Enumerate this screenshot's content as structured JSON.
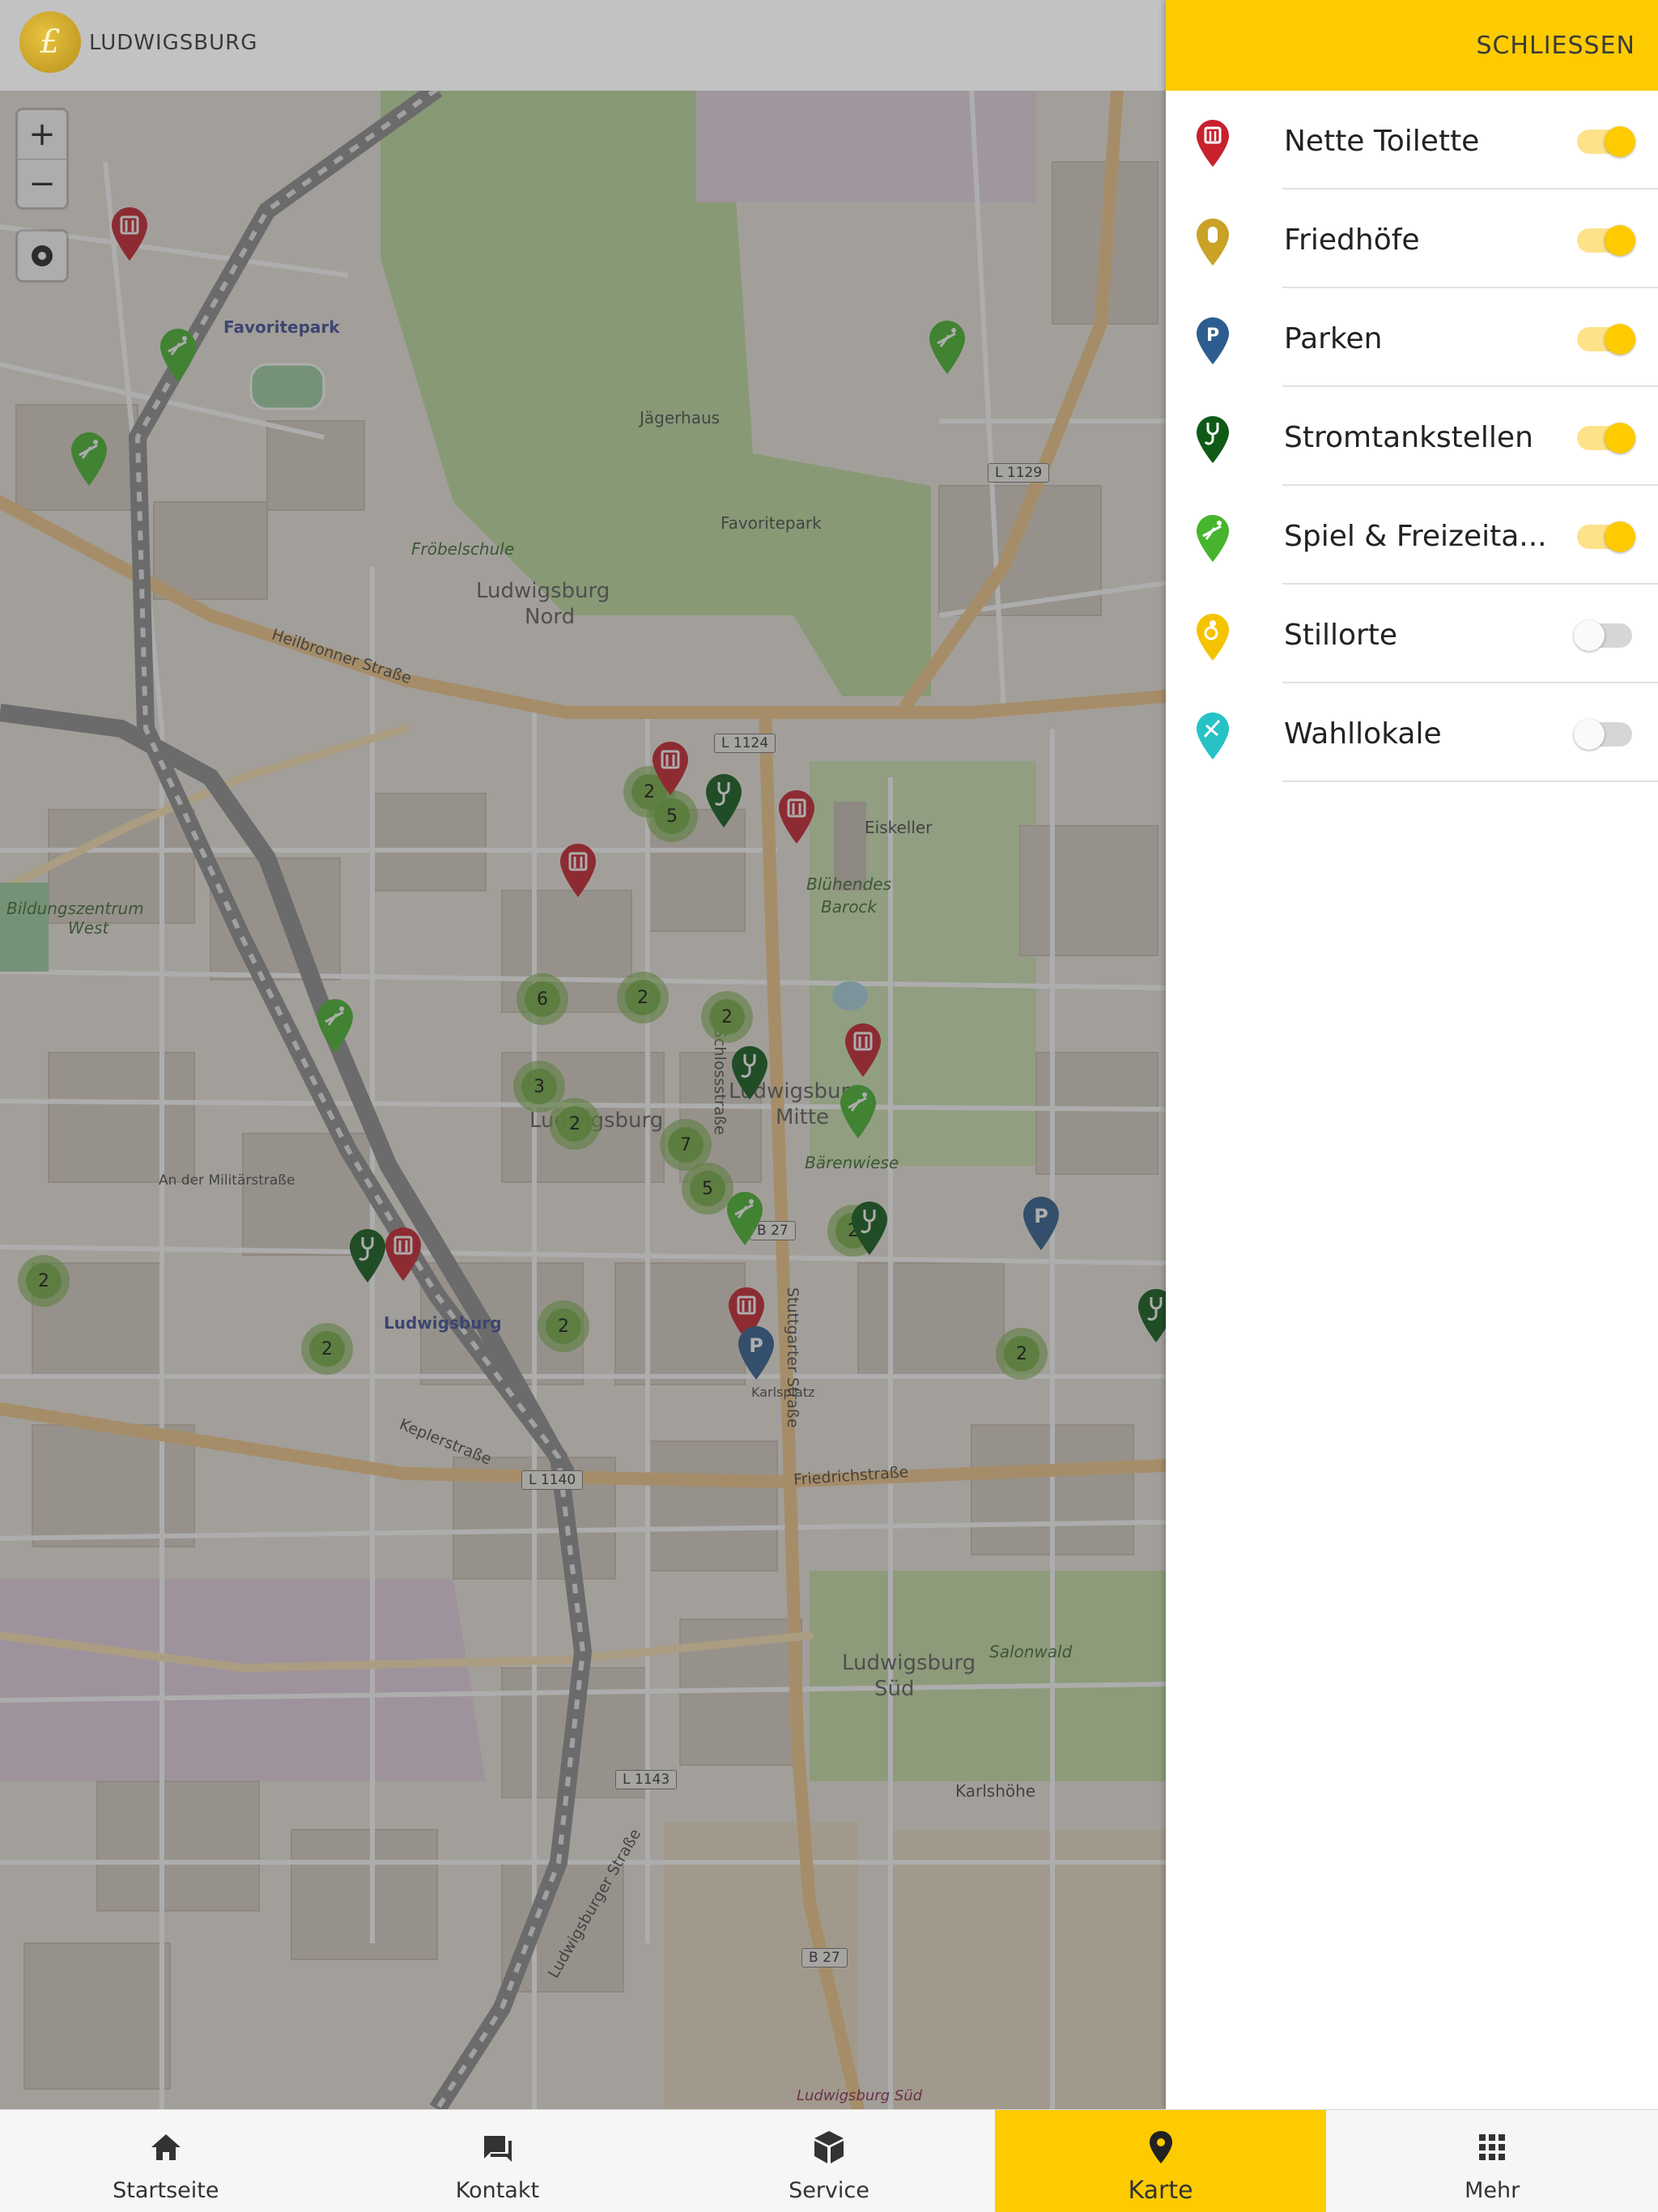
{
  "header": {
    "brand": "LUDWIGSBURG",
    "logo_letter": "£"
  },
  "map": {
    "zoom_in": "+",
    "zoom_out": "−",
    "labels": {
      "favoritepark_blue": "Favoritepark",
      "jaegerhaus": "Jägerhaus",
      "favoritepark": "Favoritepark",
      "frobelschule": "Fröbelschule",
      "ludwigsburg_nord_1": "Ludwigsburg",
      "ludwigsburg_nord_2": "Nord",
      "heilbronner": "Heilbronner Straße",
      "bluehendes_1": "Blühendes",
      "bluehendes_2": "Barock",
      "eiskeller": "Eiskeller",
      "bildungszentrum_1": "Bildungszentrum",
      "bildungszentrum_2": "West",
      "ludwigsburg_mitte_1": "Ludwigsburg",
      "ludwigsburg_mitte_2": "Mitte",
      "barenwiese": "Bärenwiese",
      "ludwigsburg_center": "Ludwigsburg",
      "ludwigsburg_blue": "Ludwigsburg",
      "an_der_militaerstrasse": "An der Militärstraße",
      "friedrichstrasse": "Friedrichstraße",
      "keplerstrasse": "Keplerstraße",
      "salonwald": "Salonwald",
      "ludwigsburg_sued_1": "Ludwigsburg",
      "ludwigsburg_sued_2": "Süd",
      "karlshoehe": "Karlshöhe",
      "schlossstrasse": "Schlossstraße",
      "stuttgarter": "Stuttgarter Straße",
      "ludwigsburger_strasse": "Ludwigsburger Straße",
      "l1124": "L 1124",
      "l1129": "L 1129",
      "l1140": "L 1140",
      "l1143": "L 1143",
      "b27": "B 27",
      "b27_south": "B 27",
      "ludwigsburg_sued_rail": "Ludwigsburg Süd",
      "karlsplatz": "Karlsplatz"
    },
    "clusters": [
      "2",
      "5",
      "6",
      "2",
      "2",
      "3",
      "2",
      "7",
      "5",
      "2",
      "2",
      "2",
      "2",
      "2"
    ]
  },
  "panel": {
    "close_label": "SCHLIESSEN",
    "filters": [
      {
        "label": "Nette Toilette",
        "enabled": true,
        "color": "#c8202c",
        "icon": "toilet-pin-icon"
      },
      {
        "label": "Friedhöfe",
        "enabled": true,
        "color": "#c9a226",
        "icon": "cemetery-pin-icon"
      },
      {
        "label": "Parken",
        "enabled": true,
        "color": "#2d5d8e",
        "icon": "parking-pin-icon"
      },
      {
        "label": "Stromtankstellen",
        "enabled": true,
        "color": "#0f5a17",
        "icon": "charging-pin-icon"
      },
      {
        "label": "Spiel & Freizeita...",
        "enabled": true,
        "color": "#46b52d",
        "icon": "playground-pin-icon"
      },
      {
        "label": "Stillorte",
        "enabled": false,
        "color": "#f5c400",
        "icon": "nursing-pin-icon"
      },
      {
        "label": "Wahllokale",
        "enabled": false,
        "color": "#27c2c6",
        "icon": "polling-pin-icon"
      }
    ],
    "toggle_on_color": "#fdcb00"
  },
  "nav": {
    "items": [
      {
        "label": "Startseite",
        "icon": "home-icon",
        "active": false
      },
      {
        "label": "Kontakt",
        "icon": "chat-icon",
        "active": false
      },
      {
        "label": "Service",
        "icon": "cube-icon",
        "active": false
      },
      {
        "label": "Karte",
        "icon": "map-pin-icon",
        "active": true
      },
      {
        "label": "Mehr",
        "icon": "grid-icon",
        "active": false
      }
    ],
    "active_color": "#fdcb00"
  }
}
